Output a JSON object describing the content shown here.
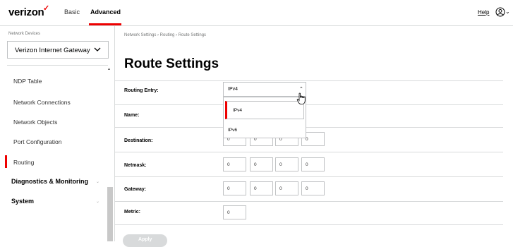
{
  "header": {
    "brand": "verizon",
    "brand_mark": "✓",
    "tabs": [
      {
        "label": "Basic"
      },
      {
        "label": "Advanced"
      }
    ],
    "help_label": "Help",
    "user_icon": "user-circle-icon"
  },
  "sidebar": {
    "devices_label": "Network Devices",
    "device_selected": "Verizon Internet Gateway",
    "items": [
      {
        "label": "NDP Table"
      },
      {
        "label": "Network Connections"
      },
      {
        "label": "Network Objects"
      },
      {
        "label": "Port Configuration"
      },
      {
        "label": "Routing"
      }
    ],
    "groups": [
      {
        "label": "Diagnostics & Monitoring"
      },
      {
        "label": "System"
      }
    ]
  },
  "breadcrumb": "Network Settings  ›  Routing  ›  Route Settings",
  "page_title": "Route Settings",
  "form": {
    "routing_entry_label": "Routing Entry:",
    "routing_entry_value": "IPv4",
    "routing_options": [
      "IPv4",
      "IPv6"
    ],
    "name_label": "Name:",
    "destination_label": "Destination:",
    "destination": [
      "0",
      "0",
      "0",
      "0"
    ],
    "netmask_label": "Netmask:",
    "netmask": [
      "0",
      "0",
      "0",
      "0"
    ],
    "gateway_label": "Gateway:",
    "gateway": [
      "0",
      "0",
      "0",
      "0"
    ],
    "metric_label": "Metric:",
    "metric": "0",
    "apply_label": "Apply"
  },
  "colors": {
    "accent": "#ee0000",
    "border": "#d8dadb",
    "muted_text": "#747676"
  }
}
